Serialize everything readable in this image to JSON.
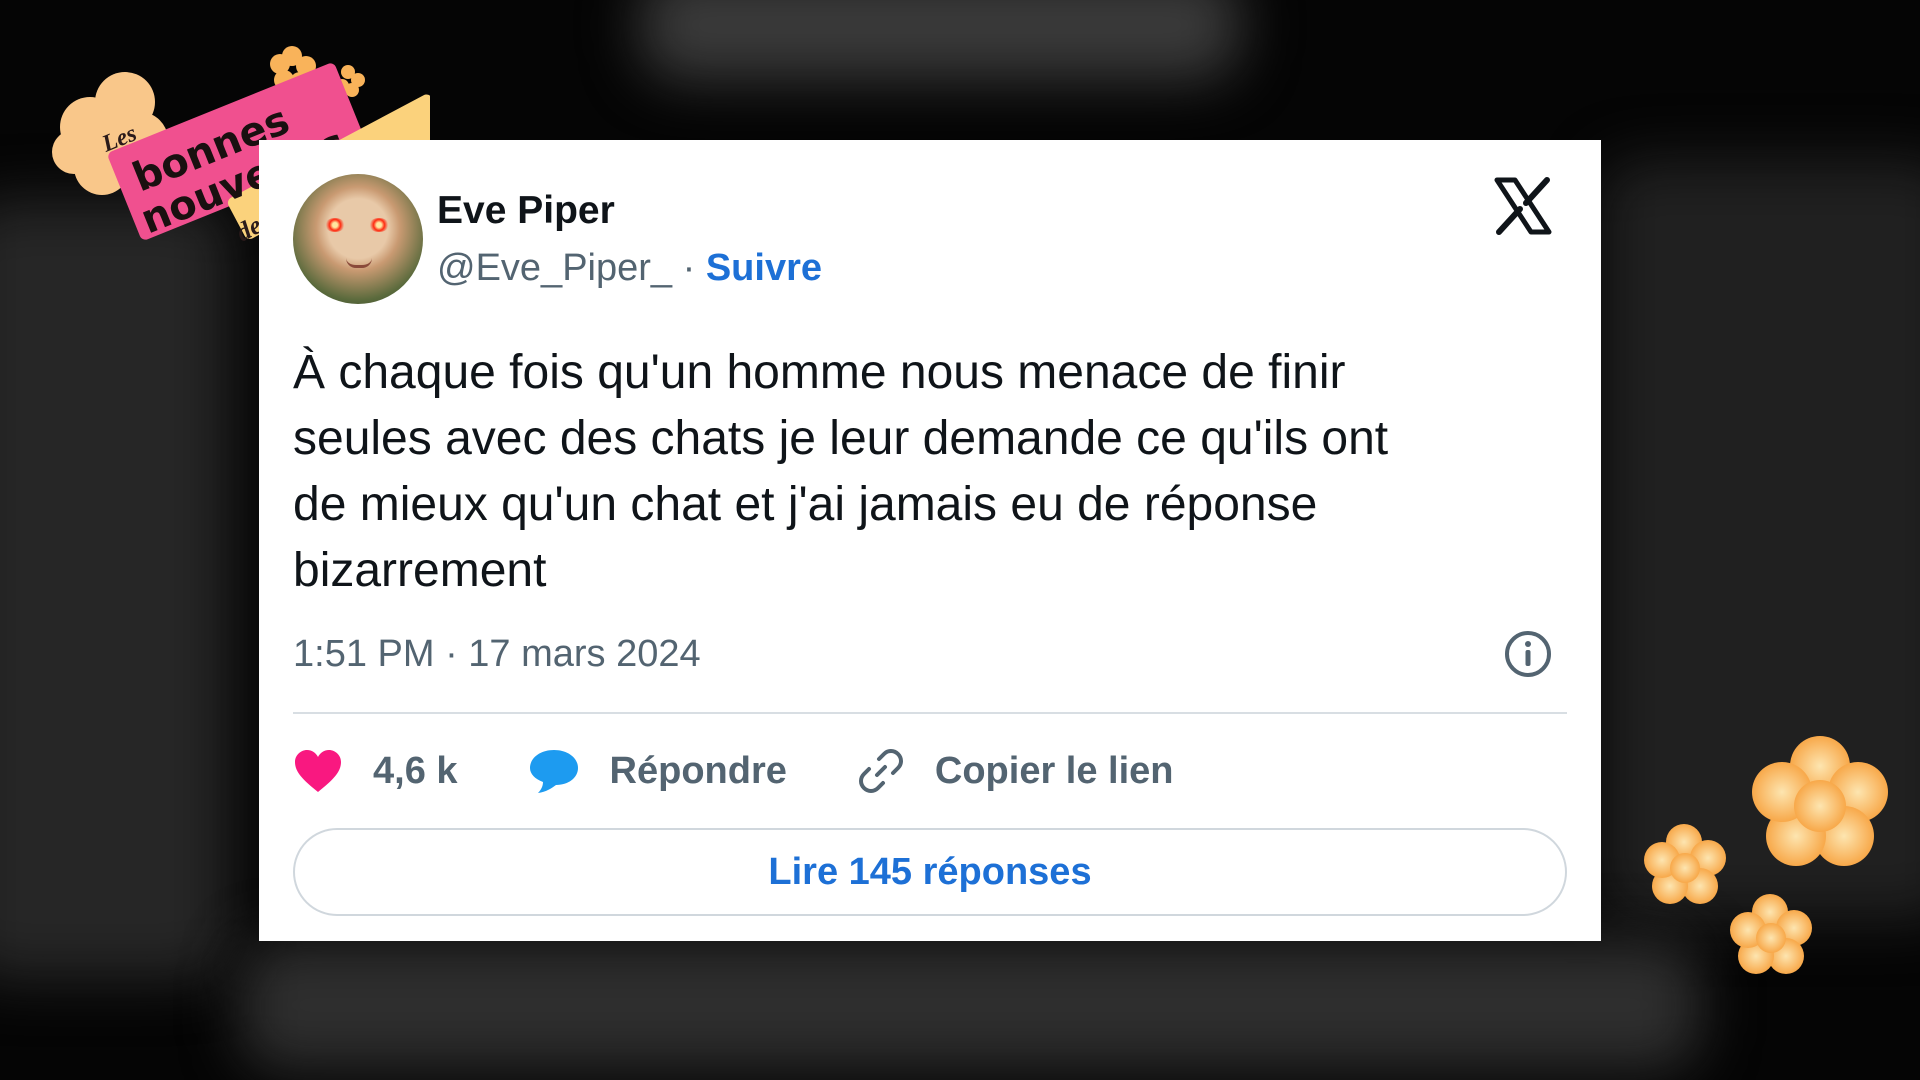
{
  "badge": {
    "line1": "Les",
    "line2": "bonnes",
    "line3": "nouvelles",
    "line4": "de la semaine"
  },
  "tweet": {
    "author_name": "Eve Piper",
    "handle": "@Eve_Piper_",
    "separator": "·",
    "follow_label": "Suivre",
    "text": "À chaque fois qu'un homme nous menace de finir\nseules avec des chats je leur demande ce qu'ils ont\nde mieux qu'un chat et j'ai jamais eu de réponse\nbizarrement",
    "timestamp": "1:51 PM · 17 mars 2024",
    "likes": "4,6 k",
    "reply_label": "Répondre",
    "copy_link_label": "Copier le lien",
    "read_replies_label": "Lire 145 réponses"
  },
  "icons": {
    "platform_logo": "x-logo-icon",
    "info": "info-icon",
    "like": "heart-icon",
    "reply": "speech-bubble-icon",
    "copy_link": "link-icon"
  },
  "colors": {
    "accent_blue": "#1d70d6",
    "heart": "#f91880",
    "reply_blue": "#1d9bf0",
    "badge_pink": "#f0508f",
    "flower_orange": "#f9a94b"
  }
}
